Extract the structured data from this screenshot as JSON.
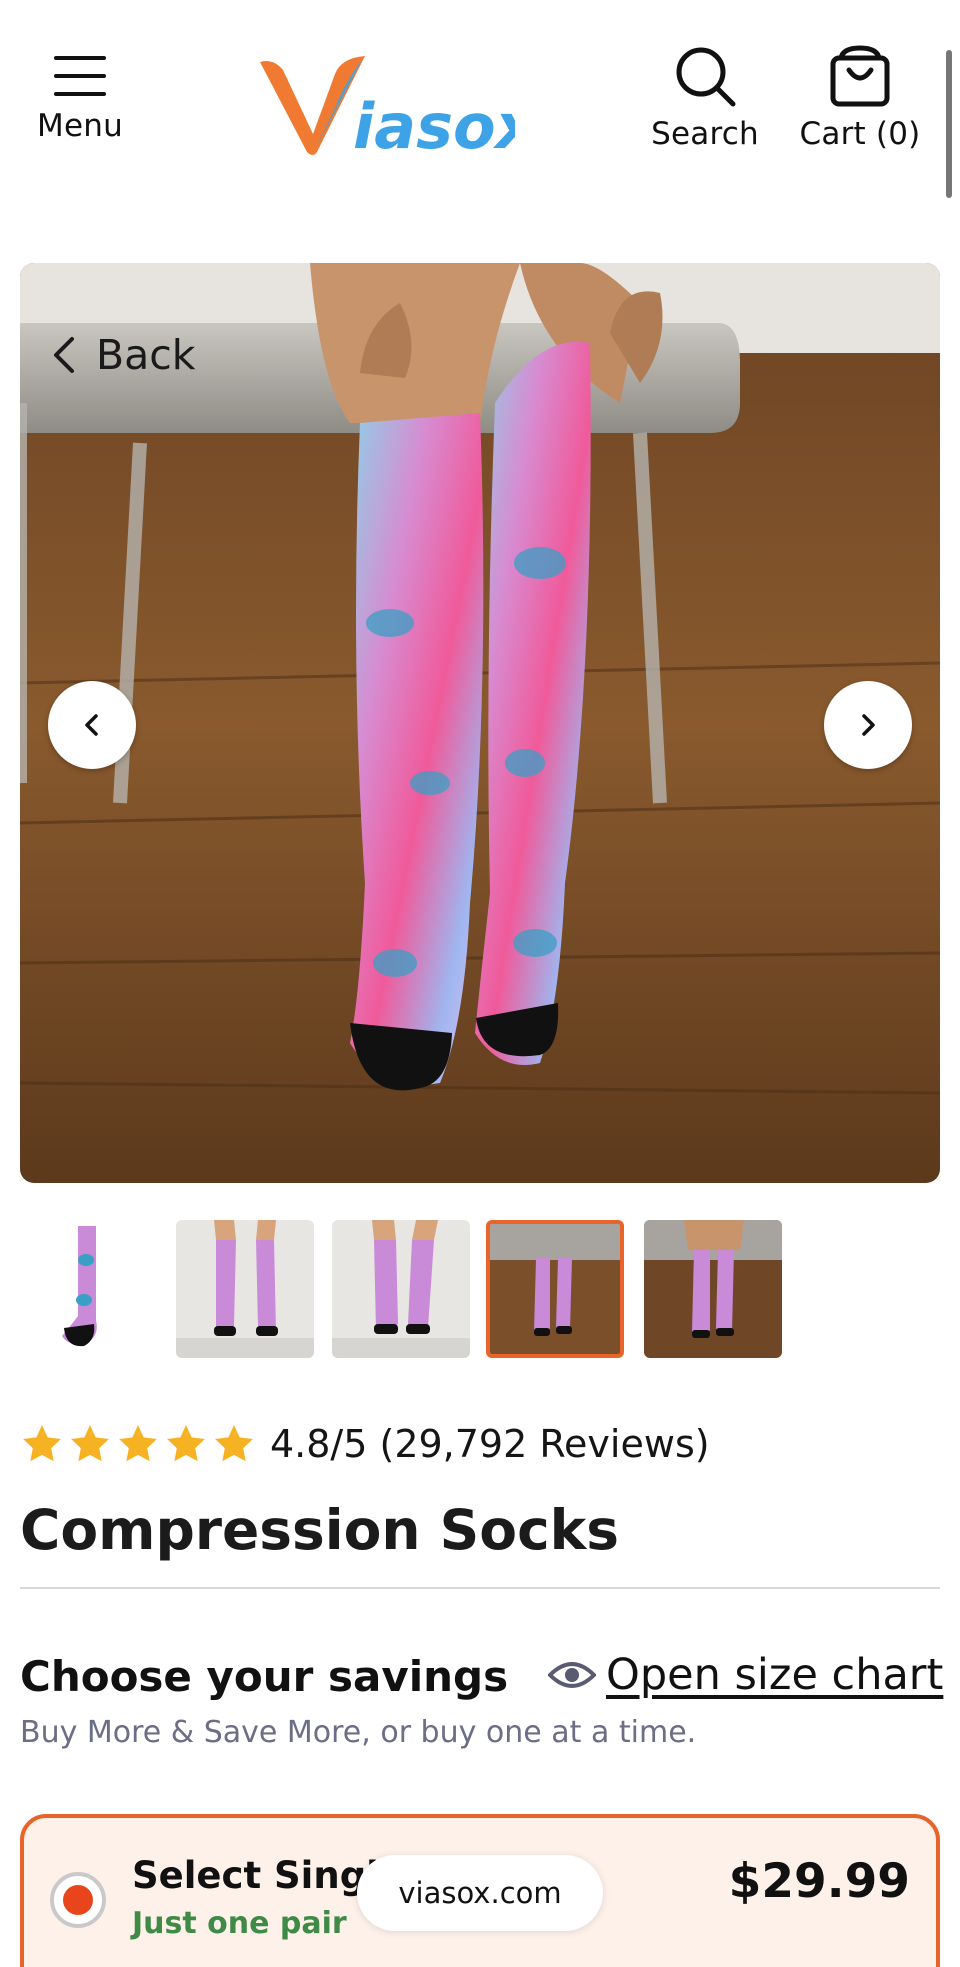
{
  "header": {
    "menu_label": "Menu",
    "search_label": "Search",
    "cart_label": "Cart (0)",
    "logo_text": "Viasox"
  },
  "gallery": {
    "back_label": "Back",
    "selected_thumbnail_index": 3,
    "thumbnail_count": 5
  },
  "product": {
    "rating_text": "4.8/5 (29,792 Reviews)",
    "stars": 5,
    "title": "Compression Socks"
  },
  "savings": {
    "heading": "Choose your savings",
    "size_chart_label": "Open size chart",
    "subtitle": "Buy More & Save More, or buy one at a time."
  },
  "offer": {
    "title": "Select Single",
    "subtitle": "Just one pair",
    "price": "$29.99",
    "selected": true
  },
  "browser": {
    "url": "viasox.com"
  },
  "colors": {
    "accent": "#e8642a",
    "star": "#f5b324",
    "green": "#3e8a46",
    "logo_orange": "#f07a32",
    "logo_blue": "#3ea3e6"
  }
}
